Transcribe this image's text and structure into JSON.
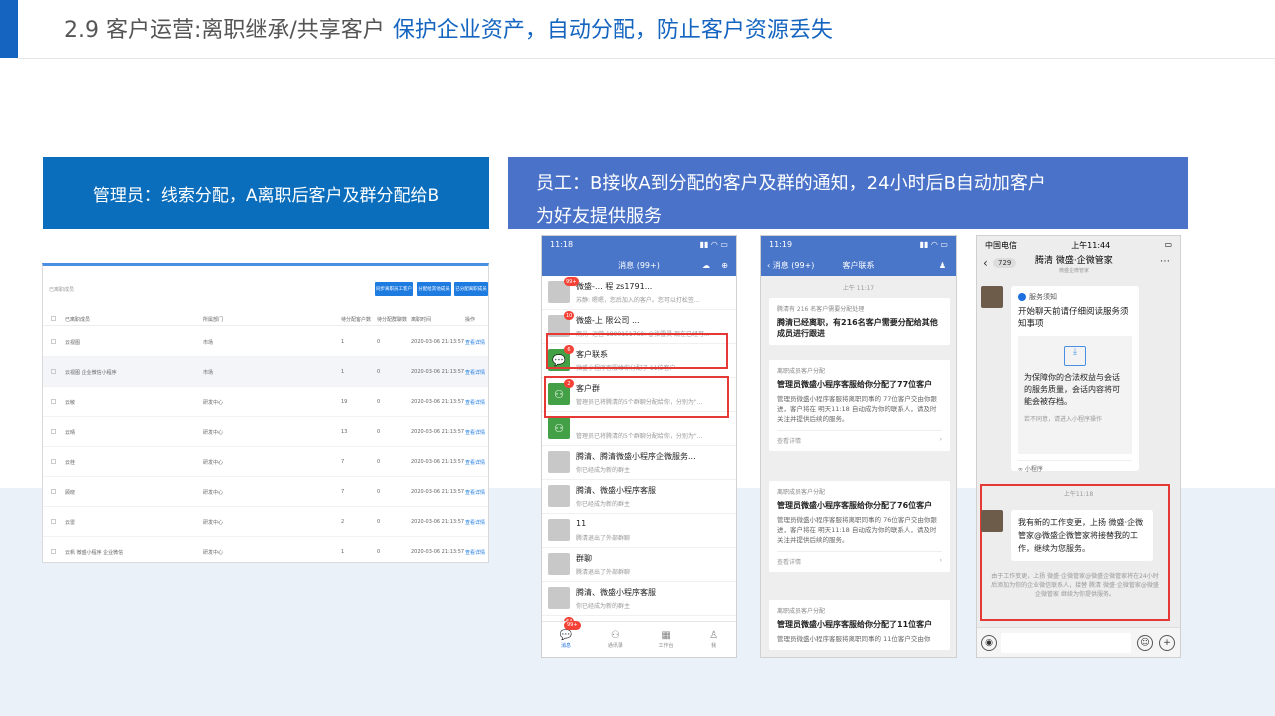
{
  "header": {
    "section": "2.9 客户运营:离职继承/共享客户",
    "tagline": "保护企业资产，自动分配，防止客户资源丢失"
  },
  "admin_banner": "管理员：线索分配，A离职后客户及群分配给B",
  "staff_banner": {
    "line1": "员工：B接收A到分配的客户及群的通知，24小时后B自动加客户",
    "line2": "为好友提供服务"
  },
  "admin_table": {
    "breadcrumb": "已离职成员",
    "buttons": [
      "同步离职员工客户",
      "分配给其他成员",
      "已分配离职成员"
    ],
    "columns": [
      "已离职成员",
      "所属部门",
      "待分配客户数",
      "待分配群聊数",
      "离职时间",
      "操作"
    ],
    "rows": [
      {
        "name": "云视图",
        "dept": "市场",
        "customers": "1",
        "groups": "0",
        "time": "2020-03-06 21:13:57",
        "action": "查看详情"
      },
      {
        "name": "云视图 企业微信小程序",
        "dept": "市场",
        "customers": "1",
        "groups": "0",
        "time": "2020-03-06 21:13:57",
        "action": "查看详情"
      },
      {
        "name": "云敏",
        "dept": "研发中心",
        "customers": "19",
        "groups": "0",
        "time": "2020-03-06 21:13:57",
        "action": "查看详情"
      },
      {
        "name": "云晴",
        "dept": "研发中心",
        "customers": "13",
        "groups": "0",
        "time": "2020-03-06 21:13:57",
        "action": "查看详情"
      },
      {
        "name": "云桂",
        "dept": "研发中心",
        "customers": "7",
        "groups": "0",
        "time": "2020-03-06 21:13:57",
        "action": "查看详情"
      },
      {
        "name": "顾晓",
        "dept": "研发中心",
        "customers": "7",
        "groups": "0",
        "time": "2020-03-06 21:13:57",
        "action": "查看详情"
      },
      {
        "name": "云雷",
        "dept": "研发中心",
        "customers": "2",
        "groups": "0",
        "time": "2020-03-06 21:13:57",
        "action": "查看详情"
      },
      {
        "name": "云帆 微盛小程序 企业微信",
        "dept": "研发中心",
        "customers": "1",
        "groups": "0",
        "time": "2020-03-06 21:13:57",
        "action": "查看详情"
      }
    ]
  },
  "phone1": {
    "time": "11:18",
    "title": "消息 (99+)",
    "messages": [
      {
        "title": "微盛-…               程 zs1791...",
        "preview": "苏静: 嗯嗯，您后加入的客户。您可以打松签...",
        "badge": "99+"
      },
      {
        "title": "微盛-上                   限公司 ...",
        "preview": "雨光 -运营 1890151769: @张雪灵 现在已经可...",
        "badge": "10"
      },
      {
        "title": "客户联系",
        "preview": "微盛小程序客服给你分配了 11位客户",
        "badge": "6"
      },
      {
        "title": "客户群",
        "preview": "管理员已将腾清的5个群聊分配给你，分别为\"...",
        "badge": "2"
      },
      {
        "title": "",
        "preview": "管理员已将腾清的5个群聊分配给你，分别为\"..."
      },
      {
        "title": "腾清、腾清微盛小程序企微服务...",
        "preview": "你已经成为新的群主"
      },
      {
        "title": "腾清、微盛小程序客服",
        "preview": "你已经成为新的群主"
      },
      {
        "title": "11",
        "preview": "腾清退出了外部群聊"
      },
      {
        "title": "群聊",
        "preview": "腾清退出了外部群聊"
      },
      {
        "title": "腾清、微盛小程序客服",
        "preview": "你已经成为新的群主"
      },
      {
        "title": "3中国人民银行              行 dj...",
        "preview": "",
        "badge": "64"
      }
    ],
    "tabs": [
      "消息",
      "通讯录",
      "工作台",
      "我"
    ],
    "tab_badge": "99+"
  },
  "phone2": {
    "time": "11:19",
    "back": "消息 (99+)",
    "title": "客户联系",
    "timestamp": "上午 11:17",
    "first_card": {
      "small": "腾清有 216 名客户需要分配处理",
      "text": "腾清已经离职，有216名客户需要分配给其他成员进行跟进"
    },
    "cards": [
      {
        "label": "离职成员客户分配",
        "head": "管理员微盛小程序客服给你分配了77位客户",
        "body": "管理员微盛小程序客服将离职同事的 77位客户交由你跟进，客户将在 明天11:18 自动成为你的联系人，请及时关注并提供后续的服务。",
        "foot": "查看详情"
      },
      {
        "label": "离职成员客户分配",
        "head": "管理员微盛小程序客服给你分配了76位客户",
        "body": "管理员微盛小程序客服将离职同事的 76位客户交由你跟进，客户将在 明天11:18 自动成为你的联系人，请及时关注并提供后续的服务。",
        "foot": "查看详情"
      },
      {
        "label": "离职成员客户分配",
        "head": "管理员微盛小程序客服给你分配了11位客户",
        "body": "管理员微盛小程序客服将离职同事的 11位客户交由你",
        "foot": ""
      }
    ]
  },
  "phone3": {
    "carrier": "中国电信",
    "time": "上午11:44",
    "back_count": "729",
    "title": "腾清 微盛·企微管家",
    "subtitle": "微盛企微管家",
    "notice": {
      "label": "服务须知",
      "title": "开始聊天前请仔细阅读服务须知事项",
      "body": "为保障你的合法权益与会话的服务质量，会话内容将可能会被存档。",
      "link": "若不同意，请进入小程序操作",
      "footer": "小程序"
    },
    "timestamp": "上午11:18",
    "message": "我有新的工作变更，上扬 微盛·企微管家@微盛企微管家将接替我的工作，继续为您服务。",
    "system": "由于工作变更，上扬 微盛·企微管家@微盛企微管家将在24小时后添加为你的企业微信联系人，接替 腾清 微盛·企微管家@微盛企微管家 继续为你提供服务。"
  }
}
